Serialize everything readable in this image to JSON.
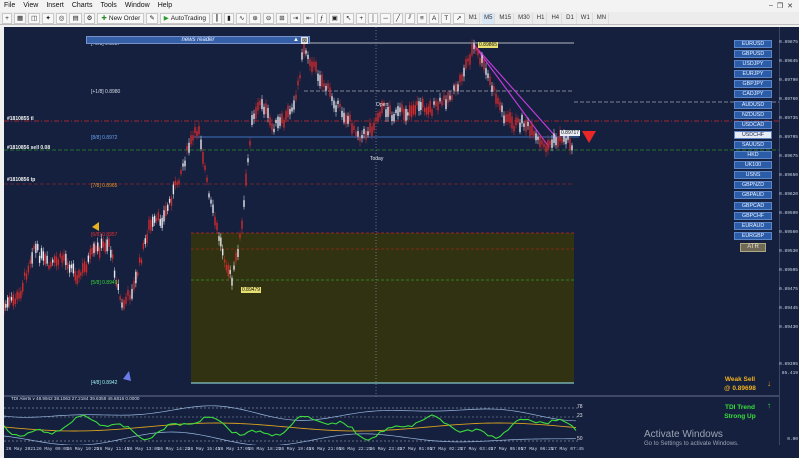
{
  "menu": {
    "items": [
      "File",
      "View",
      "Insert",
      "Charts",
      "Tools",
      "Window",
      "Help"
    ]
  },
  "toolbar": {
    "new_order": "New Order",
    "auto_trading": "AutoTrading",
    "timeframes": [
      "M1",
      "M5",
      "M15",
      "M30",
      "H1",
      "H4",
      "D1",
      "W1",
      "MN"
    ],
    "active_timeframe": "M5"
  },
  "news_reader": {
    "title": "news reader"
  },
  "symbols": {
    "items": [
      "EURUSD",
      "GBPUSD",
      "USDJPY",
      "EURJPY",
      "GBPJPY",
      "CADJPY",
      "AUDUSD",
      "NZDUSD",
      "USDCAD",
      "USDCHF",
      "SAUUSD",
      "HKD",
      "UK100",
      "USNS",
      "GBPNZD",
      "GBPAUD",
      "GBPCAD",
      "GBPCHF",
      "EURAUD",
      "EURGBP"
    ],
    "selected": "USDCHF",
    "atr_label": "ATR"
  },
  "levels": {
    "l28": "[+2/8]  0.8987",
    "l18": "[+1/8]  0.8980",
    "l88": "[8/8]  0.8972",
    "l78": "[7/8]  0.8965",
    "l68": "[6/8]  0.8957",
    "l58": "[5/8]  0.8949",
    "l48": "[4/8]  0.8942",
    "order1": "#1810855 tl",
    "order2": "#1810856 sell 0.08",
    "order3": "#1810856 tp",
    "high_label": "0.89865",
    "low_label": "0.89479",
    "bid_label": "0.89717",
    "open_label": "Open",
    "today_label": "Today"
  },
  "price_axis": {
    "labels": [
      "0.89875",
      "0.89845",
      "0.89790",
      "0.89760",
      "0.89735",
      "0.89705",
      "0.89675",
      "0.89650",
      "0.89620",
      "0.89590",
      "0.89560",
      "0.89530",
      "0.89505",
      "0.89475",
      "0.89445",
      "0.89430",
      "0.89395"
    ],
    "ind_labels": [
      "86.419",
      "0.00"
    ]
  },
  "time_axis": {
    "labels": [
      "26 May 2021",
      "26 May 09:05",
      "26 May 10:25",
      "26 May 11:45",
      "26 May 13:05",
      "26 May 14:25",
      "26 May 15:45",
      "26 May 17:05",
      "26 May 18:25",
      "26 May 19:45",
      "26 May 21:05",
      "26 May 22:25",
      "26 May 23:45",
      "27 May 01:05",
      "27 May 02:25",
      "27 May 03:45",
      "27 May 05:05",
      "27 May 06:25",
      "27 May 07:45"
    ]
  },
  "indicator": {
    "title": "TDI Alerts v 48.9942 38.1063 27.2184 39.6359 46.6816 0.0000",
    "level_labels": [
      "78",
      "50",
      "23"
    ],
    "signal1": "Weak Sell",
    "signal1_price": "@ 0.89698",
    "signal2": "TDI Trend",
    "signal2_sub": "Strong Up",
    "down_arrow": "↓",
    "up_arrow": "↑"
  },
  "watermark": {
    "title": "Activate Windows",
    "subtitle": "Go to Settings to activate Windows."
  },
  "colors": {
    "background": "#14203e",
    "bull": "#e8e8f0",
    "bear": "#d22a2a",
    "tdi_green": "#3ddc3d",
    "tdi_yellow": "#d8a020",
    "tdi_band": "#9ab8e0",
    "zone": "#3a3a0c"
  }
}
